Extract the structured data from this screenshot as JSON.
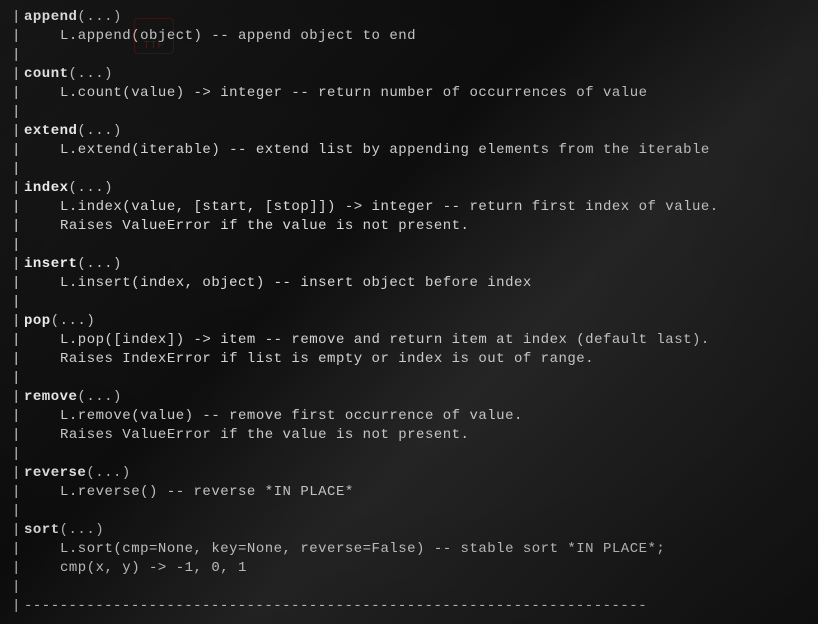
{
  "methods": [
    {
      "name": "append",
      "args": "(...)",
      "body": [
        "L.append(object) -- append object to end"
      ]
    },
    {
      "name": "count",
      "args": "(...)",
      "body": [
        "L.count(value) -> integer -- return number of occurrences of value"
      ]
    },
    {
      "name": "extend",
      "args": "(...)",
      "body": [
        "L.extend(iterable) -- extend list by appending elements from the iterable"
      ]
    },
    {
      "name": "index",
      "args": "(...)",
      "body": [
        "L.index(value, [start, [stop]]) -> integer -- return first index of value.",
        "Raises ValueError if the value is not present."
      ]
    },
    {
      "name": "insert",
      "args": "(...)",
      "body": [
        "L.insert(index, object) -- insert object before index"
      ]
    },
    {
      "name": "pop",
      "args": "(...)",
      "body": [
        "L.pop([index]) -> item -- remove and return item at index (default last).",
        "Raises IndexError if list is empty or index is out of range."
      ]
    },
    {
      "name": "remove",
      "args": "(...)",
      "body": [
        "L.remove(value) -- remove first occurrence of value.",
        "Raises ValueError if the value is not present."
      ]
    },
    {
      "name": "reverse",
      "args": "(...)",
      "body": [
        "L.reverse() -- reverse *IN PLACE*"
      ]
    },
    {
      "name": "sort",
      "args": "(...)",
      "body": [
        "L.sort(cmp=None, key=None, reverse=False) -- stable sort *IN PLACE*;",
        "cmp(x, y) -> -1, 0, 1"
      ]
    }
  ],
  "divider": "----------------------------------------------------------------------",
  "pipe": "|",
  "ttf_label": "TTF"
}
